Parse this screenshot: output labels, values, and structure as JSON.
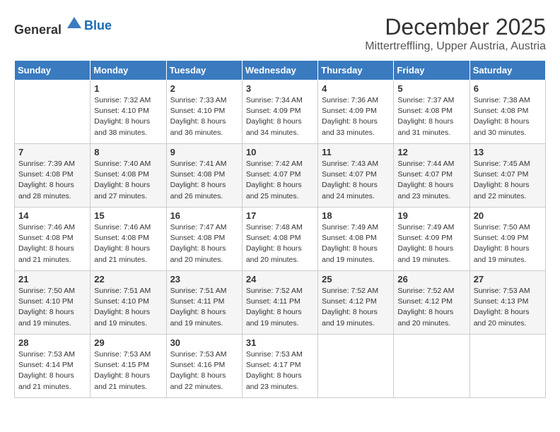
{
  "header": {
    "logo_general": "General",
    "logo_blue": "Blue",
    "month": "December 2025",
    "location": "Mittertreffling, Upper Austria, Austria"
  },
  "weekdays": [
    "Sunday",
    "Monday",
    "Tuesday",
    "Wednesday",
    "Thursday",
    "Friday",
    "Saturday"
  ],
  "weeks": [
    [
      {
        "day": "",
        "sunrise": "",
        "sunset": "",
        "daylight": ""
      },
      {
        "day": "1",
        "sunrise": "Sunrise: 7:32 AM",
        "sunset": "Sunset: 4:10 PM",
        "daylight": "Daylight: 8 hours and 38 minutes."
      },
      {
        "day": "2",
        "sunrise": "Sunrise: 7:33 AM",
        "sunset": "Sunset: 4:10 PM",
        "daylight": "Daylight: 8 hours and 36 minutes."
      },
      {
        "day": "3",
        "sunrise": "Sunrise: 7:34 AM",
        "sunset": "Sunset: 4:09 PM",
        "daylight": "Daylight: 8 hours and 34 minutes."
      },
      {
        "day": "4",
        "sunrise": "Sunrise: 7:36 AM",
        "sunset": "Sunset: 4:09 PM",
        "daylight": "Daylight: 8 hours and 33 minutes."
      },
      {
        "day": "5",
        "sunrise": "Sunrise: 7:37 AM",
        "sunset": "Sunset: 4:08 PM",
        "daylight": "Daylight: 8 hours and 31 minutes."
      },
      {
        "day": "6",
        "sunrise": "Sunrise: 7:38 AM",
        "sunset": "Sunset: 4:08 PM",
        "daylight": "Daylight: 8 hours and 30 minutes."
      }
    ],
    [
      {
        "day": "7",
        "sunrise": "Sunrise: 7:39 AM",
        "sunset": "Sunset: 4:08 PM",
        "daylight": "Daylight: 8 hours and 28 minutes."
      },
      {
        "day": "8",
        "sunrise": "Sunrise: 7:40 AM",
        "sunset": "Sunset: 4:08 PM",
        "daylight": "Daylight: 8 hours and 27 minutes."
      },
      {
        "day": "9",
        "sunrise": "Sunrise: 7:41 AM",
        "sunset": "Sunset: 4:08 PM",
        "daylight": "Daylight: 8 hours and 26 minutes."
      },
      {
        "day": "10",
        "sunrise": "Sunrise: 7:42 AM",
        "sunset": "Sunset: 4:07 PM",
        "daylight": "Daylight: 8 hours and 25 minutes."
      },
      {
        "day": "11",
        "sunrise": "Sunrise: 7:43 AM",
        "sunset": "Sunset: 4:07 PM",
        "daylight": "Daylight: 8 hours and 24 minutes."
      },
      {
        "day": "12",
        "sunrise": "Sunrise: 7:44 AM",
        "sunset": "Sunset: 4:07 PM",
        "daylight": "Daylight: 8 hours and 23 minutes."
      },
      {
        "day": "13",
        "sunrise": "Sunrise: 7:45 AM",
        "sunset": "Sunset: 4:07 PM",
        "daylight": "Daylight: 8 hours and 22 minutes."
      }
    ],
    [
      {
        "day": "14",
        "sunrise": "Sunrise: 7:46 AM",
        "sunset": "Sunset: 4:08 PM",
        "daylight": "Daylight: 8 hours and 21 minutes."
      },
      {
        "day": "15",
        "sunrise": "Sunrise: 7:46 AM",
        "sunset": "Sunset: 4:08 PM",
        "daylight": "Daylight: 8 hours and 21 minutes."
      },
      {
        "day": "16",
        "sunrise": "Sunrise: 7:47 AM",
        "sunset": "Sunset: 4:08 PM",
        "daylight": "Daylight: 8 hours and 20 minutes."
      },
      {
        "day": "17",
        "sunrise": "Sunrise: 7:48 AM",
        "sunset": "Sunset: 4:08 PM",
        "daylight": "Daylight: 8 hours and 20 minutes."
      },
      {
        "day": "18",
        "sunrise": "Sunrise: 7:49 AM",
        "sunset": "Sunset: 4:08 PM",
        "daylight": "Daylight: 8 hours and 19 minutes."
      },
      {
        "day": "19",
        "sunrise": "Sunrise: 7:49 AM",
        "sunset": "Sunset: 4:09 PM",
        "daylight": "Daylight: 8 hours and 19 minutes."
      },
      {
        "day": "20",
        "sunrise": "Sunrise: 7:50 AM",
        "sunset": "Sunset: 4:09 PM",
        "daylight": "Daylight: 8 hours and 19 minutes."
      }
    ],
    [
      {
        "day": "21",
        "sunrise": "Sunrise: 7:50 AM",
        "sunset": "Sunset: 4:10 PM",
        "daylight": "Daylight: 8 hours and 19 minutes."
      },
      {
        "day": "22",
        "sunrise": "Sunrise: 7:51 AM",
        "sunset": "Sunset: 4:10 PM",
        "daylight": "Daylight: 8 hours and 19 minutes."
      },
      {
        "day": "23",
        "sunrise": "Sunrise: 7:51 AM",
        "sunset": "Sunset: 4:11 PM",
        "daylight": "Daylight: 8 hours and 19 minutes."
      },
      {
        "day": "24",
        "sunrise": "Sunrise: 7:52 AM",
        "sunset": "Sunset: 4:11 PM",
        "daylight": "Daylight: 8 hours and 19 minutes."
      },
      {
        "day": "25",
        "sunrise": "Sunrise: 7:52 AM",
        "sunset": "Sunset: 4:12 PM",
        "daylight": "Daylight: 8 hours and 19 minutes."
      },
      {
        "day": "26",
        "sunrise": "Sunrise: 7:52 AM",
        "sunset": "Sunset: 4:12 PM",
        "daylight": "Daylight: 8 hours and 20 minutes."
      },
      {
        "day": "27",
        "sunrise": "Sunrise: 7:53 AM",
        "sunset": "Sunset: 4:13 PM",
        "daylight": "Daylight: 8 hours and 20 minutes."
      }
    ],
    [
      {
        "day": "28",
        "sunrise": "Sunrise: 7:53 AM",
        "sunset": "Sunset: 4:14 PM",
        "daylight": "Daylight: 8 hours and 21 minutes."
      },
      {
        "day": "29",
        "sunrise": "Sunrise: 7:53 AM",
        "sunset": "Sunset: 4:15 PM",
        "daylight": "Daylight: 8 hours and 21 minutes."
      },
      {
        "day": "30",
        "sunrise": "Sunrise: 7:53 AM",
        "sunset": "Sunset: 4:16 PM",
        "daylight": "Daylight: 8 hours and 22 minutes."
      },
      {
        "day": "31",
        "sunrise": "Sunrise: 7:53 AM",
        "sunset": "Sunset: 4:17 PM",
        "daylight": "Daylight: 8 hours and 23 minutes."
      },
      {
        "day": "",
        "sunrise": "",
        "sunset": "",
        "daylight": ""
      },
      {
        "day": "",
        "sunrise": "",
        "sunset": "",
        "daylight": ""
      },
      {
        "day": "",
        "sunrise": "",
        "sunset": "",
        "daylight": ""
      }
    ]
  ]
}
